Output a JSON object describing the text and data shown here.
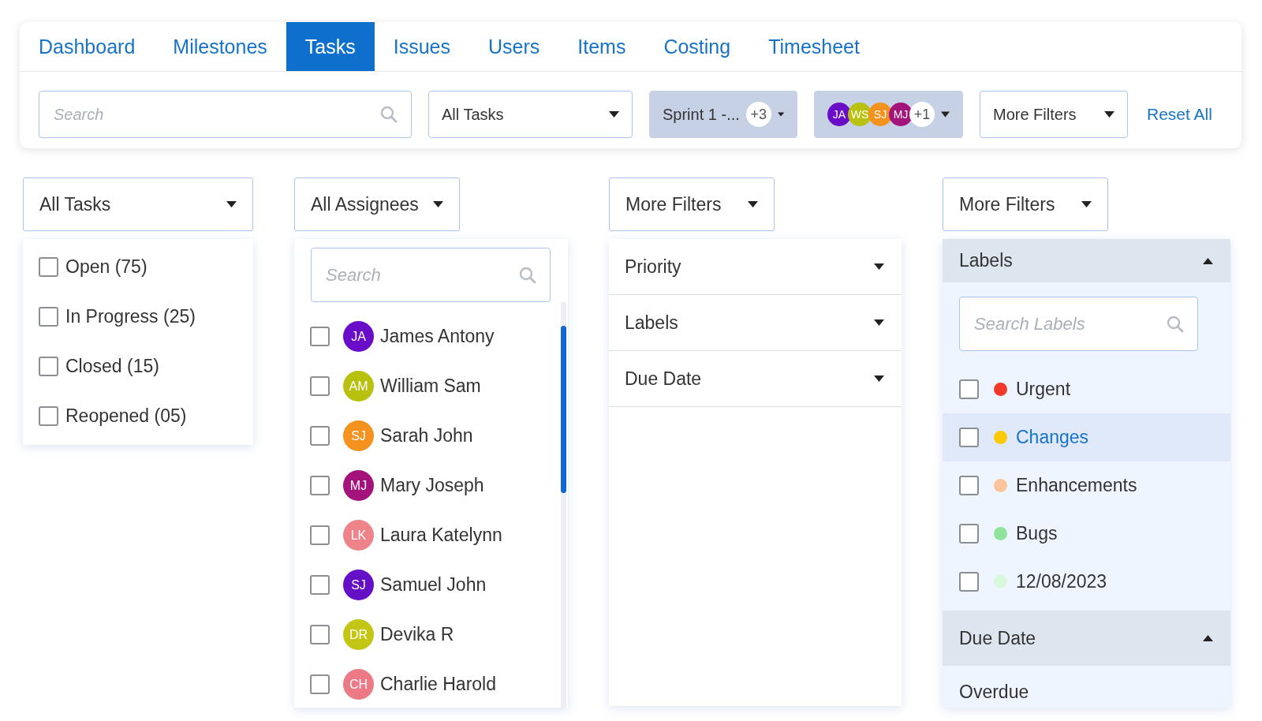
{
  "tabs": [
    {
      "label": "Dashboard",
      "selected": false
    },
    {
      "label": "Milestones",
      "selected": false
    },
    {
      "label": "Tasks",
      "selected": true
    },
    {
      "label": "Issues",
      "selected": false
    },
    {
      "label": "Users",
      "selected": false
    },
    {
      "label": "Items",
      "selected": false
    },
    {
      "label": "Costing",
      "selected": false
    },
    {
      "label": "Timesheet",
      "selected": false
    }
  ],
  "toolbar": {
    "search": {
      "placeholder": "Search"
    },
    "task_filter": {
      "value": "All Tasks"
    },
    "sprint_filter": {
      "value": "Sprint 1 -...",
      "count": "+3"
    },
    "assignee_filter": {
      "avatars": [
        {
          "initials": "JA",
          "color": "#6a0dc8"
        },
        {
          "initials": "WS",
          "color": "#b9c10f"
        },
        {
          "initials": "SJ",
          "color": "#f4921f"
        },
        {
          "initials": "MJ",
          "color": "#a3137b"
        }
      ],
      "count": "+1"
    },
    "more_filters": {
      "value": "More Filters"
    },
    "reset": "Reset All"
  },
  "task_dropdown": {
    "value": "All Tasks",
    "options": [
      {
        "label": "Open (75)",
        "checked": false
      },
      {
        "label": "In Progress (25)",
        "checked": false
      },
      {
        "label": "Closed (15)",
        "checked": false
      },
      {
        "label": "Reopened (05)",
        "checked": false
      }
    ]
  },
  "assignee_dropdown": {
    "value": "All Assignees",
    "search": {
      "placeholder": "Search"
    },
    "people": [
      {
        "name": "James Antony",
        "initials": "JA",
        "color": "#6a0dc8",
        "checked": false
      },
      {
        "name": "William Sam",
        "initials": "AM",
        "color": "#b9c10f",
        "checked": false
      },
      {
        "name": "Sarah John",
        "initials": "SJ",
        "color": "#f4921f",
        "checked": false
      },
      {
        "name": "Mary Joseph",
        "initials": "MJ",
        "color": "#a3137b",
        "checked": false
      },
      {
        "name": "Laura Katelynn",
        "initials": "LK",
        "color": "#ee8389",
        "checked": false
      },
      {
        "name": "Samuel John",
        "initials": "SJ",
        "color": "#6411c6",
        "checked": false
      },
      {
        "name": "Devika R",
        "initials": "DR",
        "color": "#c3c614",
        "checked": false
      },
      {
        "name": "Charlie Harold",
        "initials": "CH",
        "color": "#eb7a86",
        "checked": false
      }
    ]
  },
  "filters_dropdown": {
    "value": "More Filters",
    "sections": [
      {
        "title": "Priority",
        "expanded": false
      },
      {
        "title": "Labels",
        "expanded": false
      },
      {
        "title": "Due Date",
        "expanded": false
      }
    ]
  },
  "filters_dropdown_expanded": {
    "value": "More Filters",
    "labels_section": {
      "title": "Labels",
      "expanded": true,
      "search": {
        "placeholder": "Search Labels"
      },
      "labels": [
        {
          "name": "Urgent",
          "color": "#f23a2b",
          "checked": false,
          "selected": false
        },
        {
          "name": "Changes",
          "color": "#fbc905",
          "checked": false,
          "selected": true
        },
        {
          "name": "Enhancements",
          "color": "#fbc49a",
          "checked": false,
          "selected": false
        },
        {
          "name": "Bugs",
          "color": "#90e39a",
          "checked": false,
          "selected": false
        },
        {
          "name": "12/08/2023",
          "color": "#d9f9dd",
          "checked": false,
          "selected": false
        }
      ]
    },
    "due_date_section": {
      "title": "Due Date",
      "expanded": true,
      "options": [
        "Overdue"
      ]
    }
  }
}
